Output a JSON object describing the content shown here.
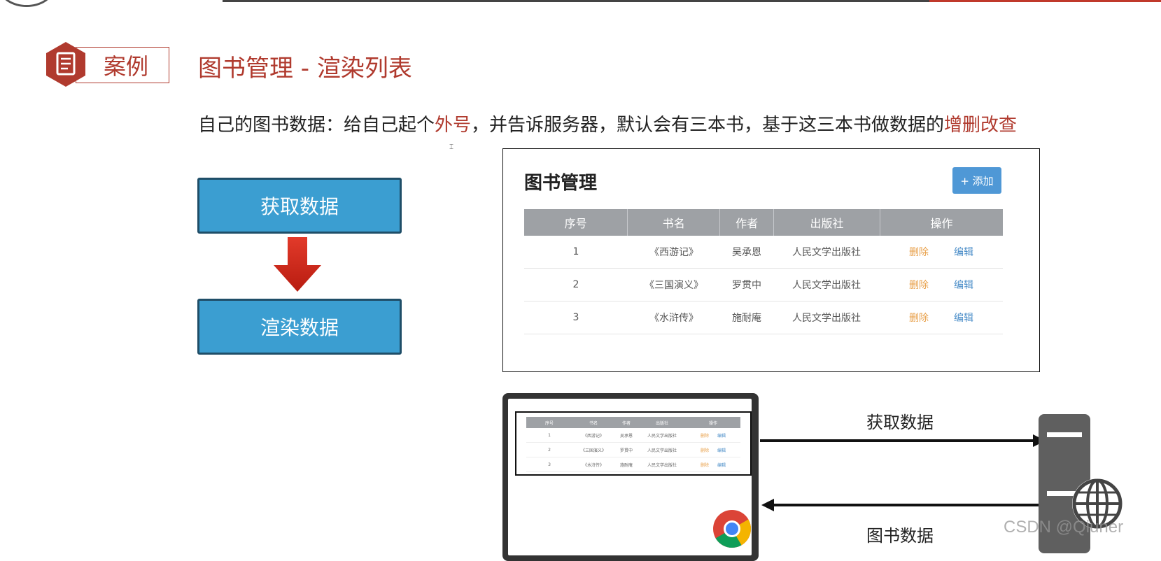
{
  "header": {
    "badge_label": "案例",
    "title": "图书管理 - 渲染列表"
  },
  "description": {
    "part1": "自己的图书数据：给自己起个",
    "highlight1": "外号",
    "part2": "，并告诉服务器，默认会有三本书，基于这三本书做数据的",
    "highlight2": "增删改查"
  },
  "flow": {
    "step1": "获取数据",
    "step2": "渲染数据"
  },
  "book_panel": {
    "title": "图书管理",
    "add_button": "+ 添加",
    "columns": [
      "序号",
      "书名",
      "作者",
      "出版社",
      "操作"
    ],
    "rows": [
      {
        "index": "1",
        "name": "《西游记》",
        "author": "吴承恩",
        "publisher": "人民文学出版社",
        "delete": "删除",
        "edit": "编辑"
      },
      {
        "index": "2",
        "name": "《三国演义》",
        "author": "罗贯中",
        "publisher": "人民文学出版社",
        "delete": "删除",
        "edit": "编辑"
      },
      {
        "index": "3",
        "name": "《水浒传》",
        "author": "施耐庵",
        "publisher": "人民文学出版社",
        "delete": "删除",
        "edit": "编辑"
      }
    ]
  },
  "diagram": {
    "request_label": "获取数据",
    "response_label": "图书数据"
  },
  "watermark": "CSDN @Qiuner",
  "colors": {
    "accent_red": "#b03a2e",
    "flow_blue": "#3b9ed1",
    "button_blue": "#4f98d6",
    "delete_orange": "#e8a04a",
    "edit_blue": "#4a8dc8"
  }
}
